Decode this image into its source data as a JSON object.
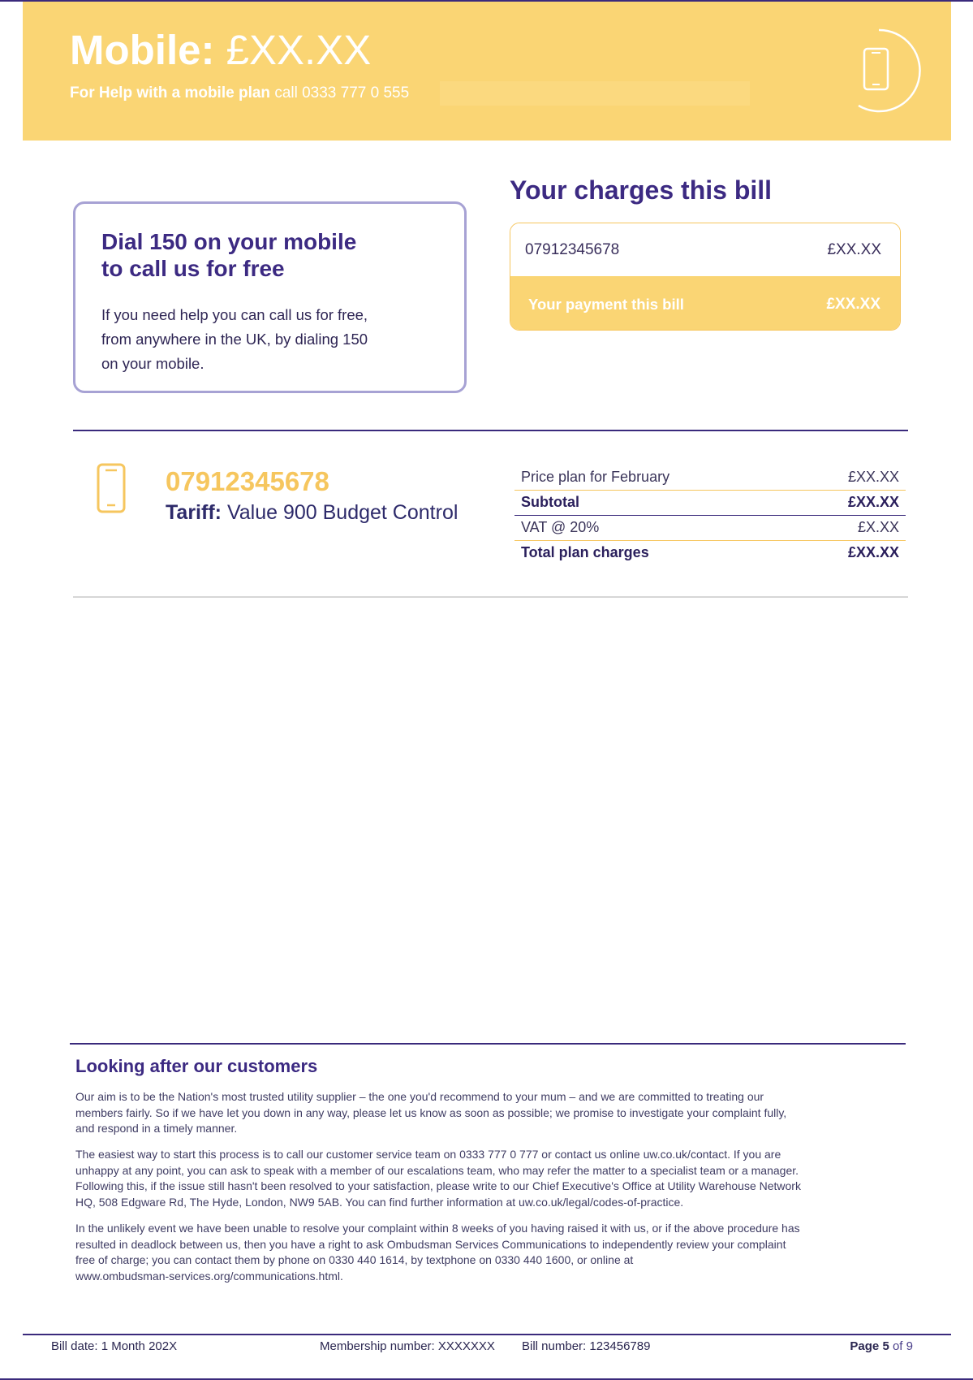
{
  "banner": {
    "title_label": "Mobile:",
    "title_amount": "£XX.XX",
    "help_bold": "For Help with a mobile plan",
    "help_text": "call 0333 777 0 555",
    "icon": "phone-circle-icon"
  },
  "help_box": {
    "heading_line1": "Dial 150 on your mobile",
    "heading_line2": "to call us for free",
    "body_line1": "If you need help you can call us for free,",
    "body_line2": "from anywhere in the UK, by dialing 150",
    "body_line3": "on your mobile."
  },
  "charges": {
    "title": "Your charges this bill",
    "number": "07912345678",
    "number_amount": "£XX.XX",
    "payment_label": "Your payment this bill",
    "payment_amount": "£XX.XX"
  },
  "line": {
    "icon": "mobile-phone-icon",
    "number": "07912345678",
    "tariff_label": "Tariff:",
    "tariff_value": "Value 900 Budget Control",
    "rows": [
      {
        "label": "Price plan for February",
        "value": "£XX.XX"
      },
      {
        "label": "Subtotal",
        "value": "£XX.XX"
      },
      {
        "label": "VAT @ 20%",
        "value": "£X.XX"
      },
      {
        "label": "Total plan charges",
        "value": "£XX.XX"
      }
    ]
  },
  "customer_care": {
    "title": "Looking after our customers",
    "para1_line1": "Our aim is to be the Nation's most trusted utility supplier – the one you'd recommend to your mum – and we are committed to treating our",
    "para1_line2": "members fairly. So if we have let you down in any way, please let us know as soon as possible; we promise to investigate your complaint fully,",
    "para1_line3": "and respond in a timely manner.",
    "para2_line1": "The easiest way to start this process is to call our customer service team on  0333 777 0 777 or contact us online uw.co.uk/contact. If you are",
    "para2_line2": "unhappy at any point, you can ask to speak with a member of our escalations team, who may refer the matter to a specialist team or a manager.",
    "para2_line3": "Following this, if the issue still hasn't been resolved to your satisfaction, please write to our Chief Executive's Office at Utility Warehouse Network",
    "para2_line4": "HQ, 508 Edgware Rd, The Hyde, London, NW9 5AB. You can find further information at uw.co.uk/legal/codes-of-practice.",
    "para3_line1": "In the unlikely event we have been unable to resolve your complaint within 8 weeks of you having raised it with us, or if the above procedure has",
    "para3_line2": "resulted in deadlock between us, then you have a right to ask Ombudsman Services Communications to independently review your complaint",
    "para3_line3": "free of charge; you can contact them by phone on 0330 440 1614, by textphone on 0330 440 1600, or online at",
    "para3_line4": "www.ombudsman-services.org/communications.html."
  },
  "footer": {
    "bill_date": "Bill date: 1 Month 202X",
    "membership": "Membership number: XXXXXXX",
    "bill_number": "Bill number: 123456789",
    "page_label": "Page 5",
    "page_of": "of 9"
  },
  "colors": {
    "accent_yellow": "#fad574",
    "brand_purple": "#3c2a82",
    "box_border": "#a7a2d4"
  }
}
